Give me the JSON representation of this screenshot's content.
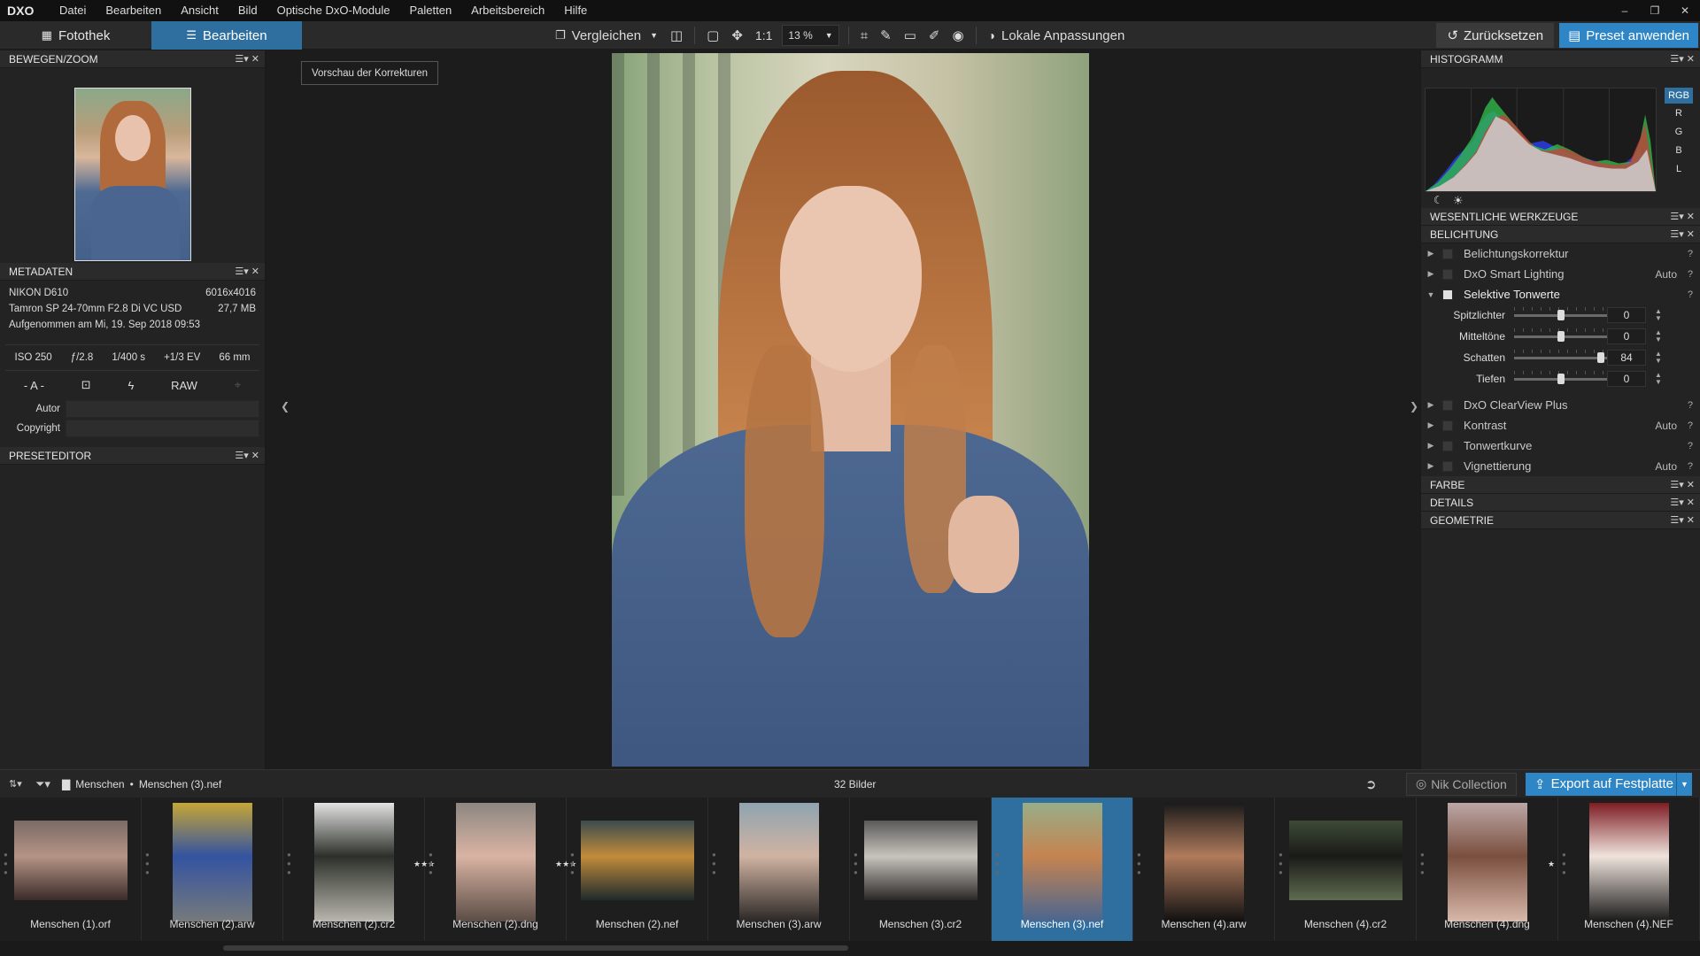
{
  "app": {
    "logo": "DXO"
  },
  "menu": [
    "Datei",
    "Bearbeiten",
    "Ansicht",
    "Bild",
    "Optische DxO-Module",
    "Paletten",
    "Arbeitsbereich",
    "Hilfe"
  ],
  "window_controls": [
    "–",
    "❐",
    "✕"
  ],
  "tabs": {
    "fotothek": "Fotothek",
    "bearbeiten": "Bearbeiten"
  },
  "toolbar": {
    "vergleichen": "Vergleichen",
    "one_to_one": "1:1",
    "zoom": "13 %",
    "lokale": "Lokale Anpassungen",
    "zuruecksetzen": "Zurücksetzen",
    "preset": "Preset anwenden"
  },
  "left": {
    "bewegen_title": "BEWEGEN/ZOOM",
    "metadaten_title": "METADATEN",
    "camera": "NIKON D610",
    "resolution": "6016x4016",
    "lens": "Tamron SP 24-70mm F2.8 Di VC USD",
    "filesize": "27,7 MB",
    "taken": "Aufgenommen am Mi, 19. Sep 2018 09:53",
    "exif": [
      "ISO 250",
      "ƒ/2.8",
      "1/400 s",
      "+1/3 EV",
      "66 mm"
    ],
    "mode": "- A -",
    "raw": "RAW",
    "autor_label": "Autor",
    "copyright_label": "Copyright",
    "preseteditor_title": "PRESETEDITOR"
  },
  "center": {
    "preview_button": "Vorschau der Korrekturen"
  },
  "right": {
    "histogramm_title": "HISTOGRAMM",
    "channels": [
      "RGB",
      "R",
      "G",
      "B",
      "L"
    ],
    "wesentliche_title": "WESENTLICHE WERKZEUGE",
    "belichtung_title": "BELICHTUNG",
    "tools_top": [
      {
        "label": "Belichtungskorrektur",
        "auto": ""
      },
      {
        "label": "DxO Smart Lighting",
        "auto": "Auto"
      }
    ],
    "selektive": "Selektive Tonwerte",
    "sliders": [
      {
        "label": "Spitzlichter",
        "value": "0",
        "pos": 0.5
      },
      {
        "label": "Mitteltöne",
        "value": "0",
        "pos": 0.5
      },
      {
        "label": "Schatten",
        "value": "84",
        "pos": 0.92
      },
      {
        "label": "Tiefen",
        "value": "0",
        "pos": 0.5
      }
    ],
    "tools_bottom": [
      {
        "label": "DxO ClearView Plus",
        "auto": ""
      },
      {
        "label": "Kontrast",
        "auto": "Auto"
      },
      {
        "label": "Tonwertkurve",
        "auto": ""
      },
      {
        "label": "Vignettierung",
        "auto": "Auto"
      }
    ],
    "farbe_title": "FARBE",
    "details_title": "DETAILS",
    "geometrie_title": "GEOMETRIE"
  },
  "strip_bar": {
    "folder": "Menschen",
    "sep": "•",
    "file": "Menschen (3).nef",
    "count": "32 Bilder",
    "nik": "Nik Collection",
    "export": "Export auf Festplatte"
  },
  "filmstrip": [
    {
      "name": "Menschen (1).orf",
      "stars": "",
      "colors": [
        "#7b6a66",
        "#b49486",
        "#3b2b2a"
      ],
      "wide": true
    },
    {
      "name": "Menschen (2).arw",
      "stars": "",
      "colors": [
        "#c6a635",
        "#3453a1",
        "#767a7c"
      ],
      "wide": false
    },
    {
      "name": "Menschen (2).cr2",
      "stars": "★★★",
      "colors": [
        "#e3e3e1",
        "#2c302a",
        "#b8b6ad"
      ],
      "wide": false
    },
    {
      "name": "Menschen (2).dng",
      "stars": "★★★",
      "colors": [
        "#8d8781",
        "#d9b3a3",
        "#5b4d45"
      ],
      "wide": false
    },
    {
      "name": "Menschen (2).nef",
      "stars": "",
      "colors": [
        "#3a4b4f",
        "#c18c3a",
        "#1f2a2c"
      ],
      "wide": true
    },
    {
      "name": "Menschen (3).arw",
      "stars": "",
      "colors": [
        "#8fa4b0",
        "#d0b3a2",
        "#2b2826"
      ],
      "wide": false
    },
    {
      "name": "Menschen (3).cr2",
      "stars": "",
      "colors": [
        "#5a5a58",
        "#c7c3bd",
        "#2a2826"
      ],
      "wide": true
    },
    {
      "name": "Menschen (3).nef",
      "stars": "",
      "colors": [
        "#98ad88",
        "#c58450",
        "#4a6690"
      ],
      "wide": false
    },
    {
      "name": "Menschen (4).arw",
      "stars": "",
      "colors": [
        "#1a1a1a",
        "#b07b5c",
        "#111111"
      ],
      "wide": false
    },
    {
      "name": "Menschen (4).cr2",
      "stars": "",
      "colors": [
        "#3d4a36",
        "#1a1a18",
        "#5e6c4f"
      ],
      "wide": true
    },
    {
      "name": "Menschen (4).dng",
      "stars": "★",
      "colors": [
        "#bca7a5",
        "#7a4f3f",
        "#d8b8aa"
      ],
      "wide": false
    },
    {
      "name": "Menschen (4).NEF",
      "stars": "",
      "colors": [
        "#7d1d23",
        "#efe3dc",
        "#1a1a1a"
      ],
      "wide": false
    }
  ]
}
